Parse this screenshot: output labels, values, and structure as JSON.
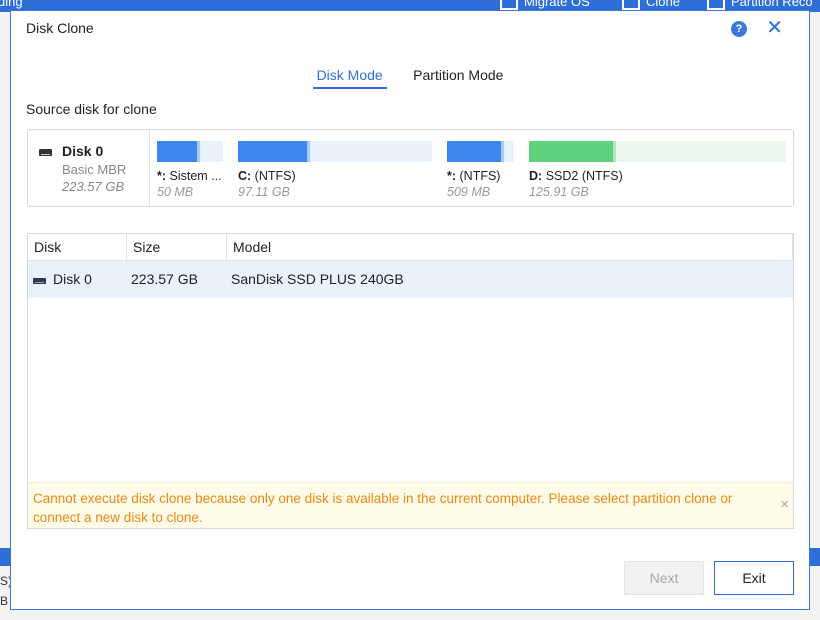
{
  "background_app": {
    "left_fragment": "ding",
    "toolbar": [
      {
        "label": "Migrate OS",
        "icon": "migrate-icon"
      },
      {
        "label": "Clone",
        "icon": "clone-icon"
      },
      {
        "label": "Partition Reco",
        "icon": "recovery-icon"
      }
    ],
    "side_fragments": [
      "S)",
      "B"
    ]
  },
  "dialog": {
    "title": "Disk Clone",
    "help_label": "?",
    "close_label": "✕",
    "tabs": [
      {
        "label": "Disk Mode",
        "active": true
      },
      {
        "label": "Partition Mode",
        "active": false
      }
    ],
    "source_label": "Source disk for clone",
    "source_disk": {
      "name": "Disk 0",
      "type": "Basic MBR",
      "size": "223.57 GB",
      "partitions": [
        {
          "letter": "*:",
          "name": "Sistem ...",
          "size": "50 MB",
          "used_fraction": 0.65,
          "color": "#3d86ec"
        },
        {
          "letter": "C:",
          "name": " (NTFS)",
          "size": "97.11 GB",
          "used_fraction": 0.37,
          "color": "#3d86ec"
        },
        {
          "letter": "*:",
          "name": " (NTFS)",
          "size": "509 MB",
          "used_fraction": 0.85,
          "color": "#3d86ec"
        },
        {
          "letter": "D:",
          "name": "SSD2 (NTFS)",
          "size": "125.91 GB",
          "used_fraction": 0.34,
          "color": "#5fd07d"
        }
      ]
    },
    "table": {
      "columns": [
        "Disk",
        "Size",
        "Model"
      ],
      "rows": [
        {
          "disk": "Disk 0",
          "size": "223.57 GB",
          "model": "SanDisk SSD PLUS 240GB"
        }
      ]
    },
    "warning": {
      "text": "Cannot execute disk clone because only one disk is available in the current computer. Please select partition clone or connect a new disk to clone.",
      "close_label": "×"
    },
    "buttons": {
      "next": "Next",
      "exit": "Exit"
    }
  }
}
